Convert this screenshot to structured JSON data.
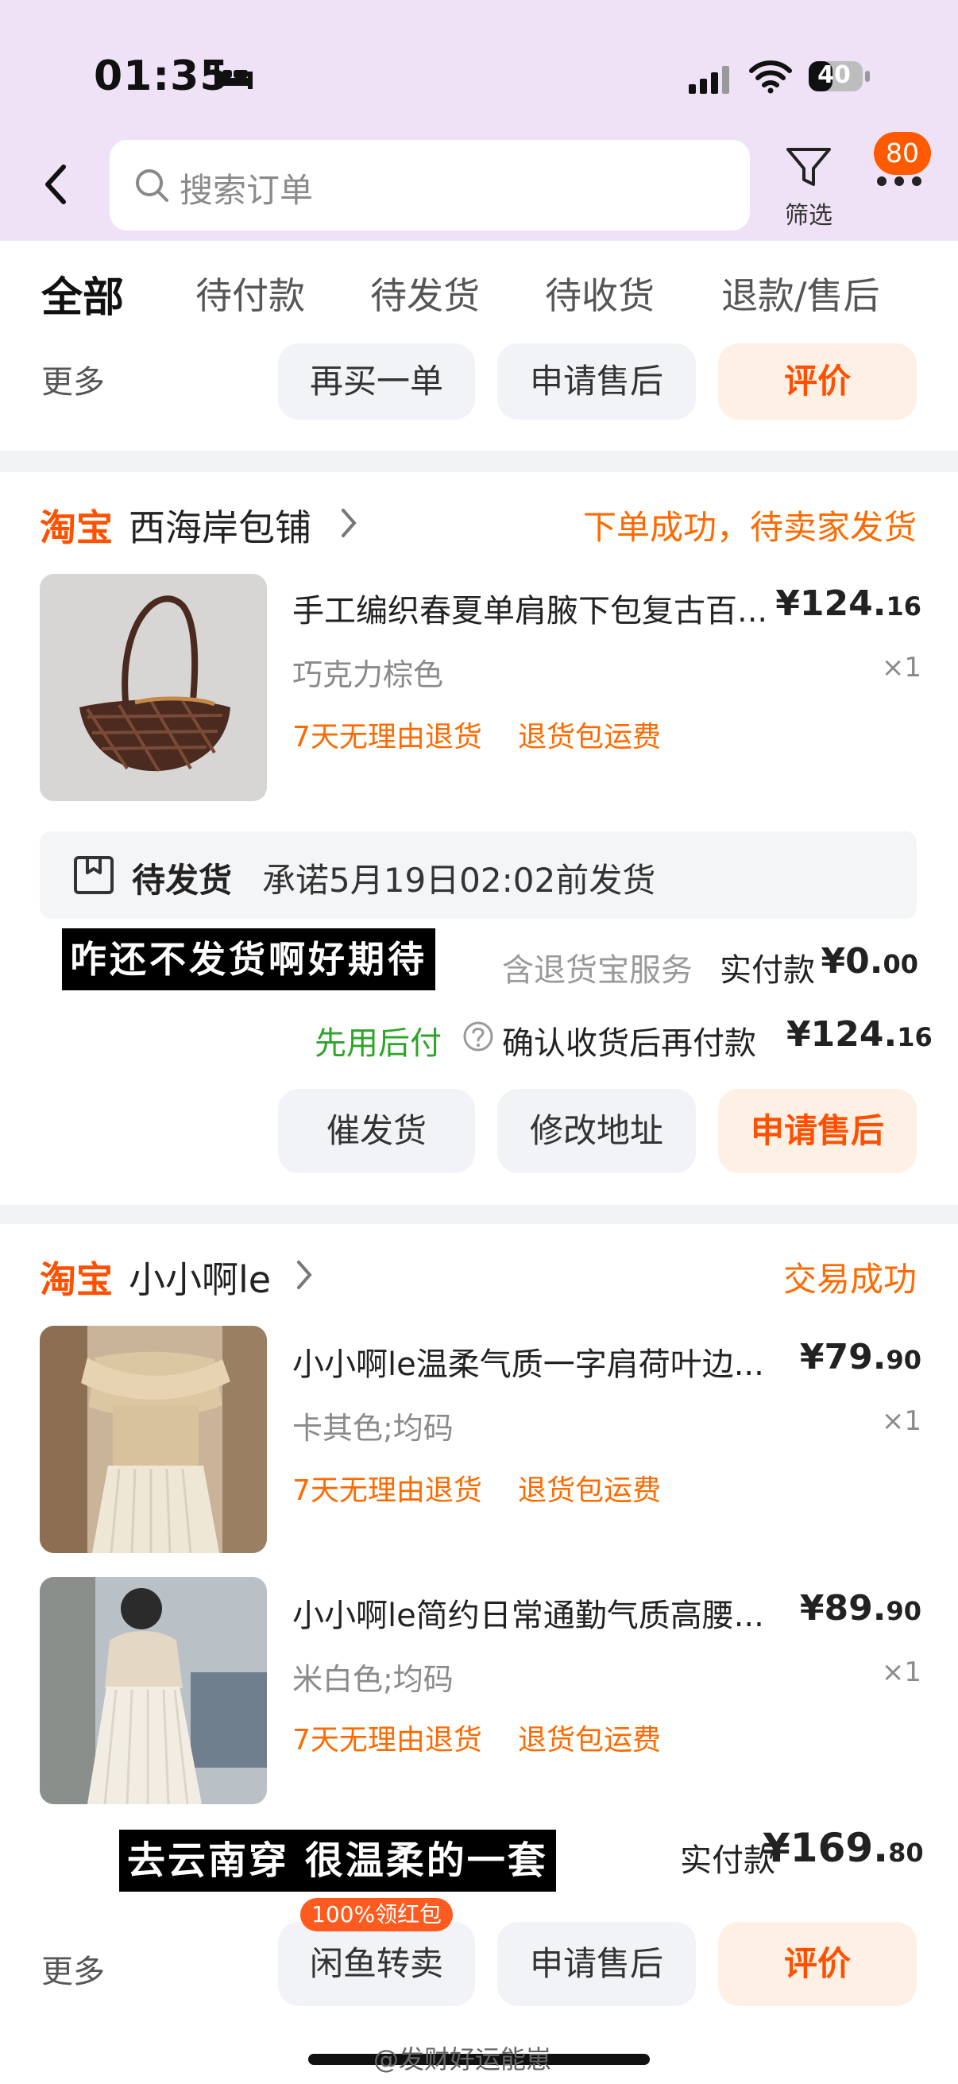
{
  "status_bar": {
    "time": "01:35",
    "battery": "40"
  },
  "search": {
    "placeholder": "搜索订单"
  },
  "filter": {
    "label": "筛选"
  },
  "more": {
    "badge": "80"
  },
  "tabs": [
    "全部",
    "待付款",
    "待发货",
    "待收货",
    "退款/售后"
  ],
  "top_card": {
    "more": "更多",
    "buttons": [
      "再买一单",
      "申请售后",
      "评价"
    ]
  },
  "order1": {
    "brand": "淘宝",
    "shop": "西海岸包铺",
    "status": "下单成功，待卖家发货",
    "item": {
      "title": "手工编织春夏单肩腋下包复古百...",
      "price_int": "¥124.",
      "price_dec": "16",
      "sku": "巧克力棕色",
      "qty": "×1",
      "tags": [
        "7天无理由退货",
        "退货包运费"
      ]
    },
    "notice": {
      "label": "待发货",
      "text": "承诺5月19日02:02前发货"
    },
    "caption": "咋还不发货啊好期待",
    "service": "含退货宝服务",
    "paid_label": "实付款",
    "paid_int": "¥0.",
    "paid_dec": "00",
    "later_pay": "先用后付",
    "confirm_text": "确认收货后再付款",
    "later_int": "¥124.",
    "later_dec": "16",
    "buttons": [
      "催发货",
      "修改地址",
      "申请售后"
    ]
  },
  "order2": {
    "brand": "淘宝",
    "shop": "小小啊le",
    "status": "交易成功",
    "items": [
      {
        "title": "小小啊le温柔气质一字肩荷叶边...",
        "price_int": "¥79.",
        "price_dec": "90",
        "sku": "卡其色;均码",
        "qty": "×1",
        "tags": [
          "7天无理由退货",
          "退货包运费"
        ]
      },
      {
        "title": "小小啊le简约日常通勤气质高腰...",
        "price_int": "¥89.",
        "price_dec": "90",
        "sku": "米白色;均码",
        "qty": "×1",
        "tags": [
          "7天无理由退货",
          "退货包运费"
        ]
      }
    ],
    "caption": "去云南穿 很温柔的一套",
    "paid_label": "实付款",
    "paid_int": "¥169.",
    "paid_dec": "80",
    "redpacket": "100%领红包",
    "more": "更多",
    "buttons": [
      "闲鱼转卖",
      "申请售后",
      "评价"
    ]
  },
  "watermark": "@发财好运能崽",
  "colors": {
    "accent": "#ff5000",
    "header": "#efe2f6",
    "green": "#2fa42b"
  }
}
